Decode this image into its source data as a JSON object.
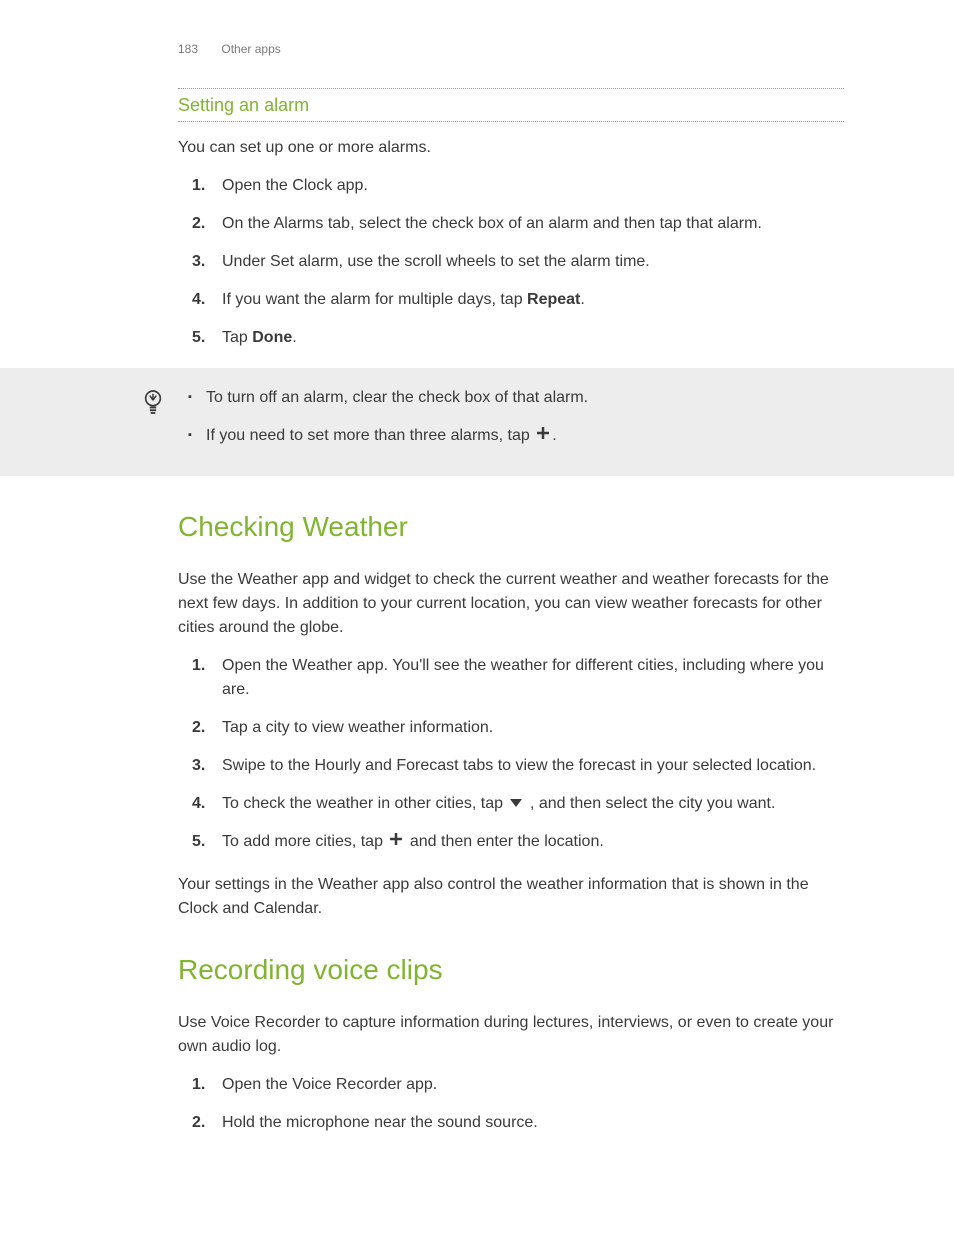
{
  "header": {
    "pageNumber": "183",
    "sectionName": "Other apps"
  },
  "alarm": {
    "subheading": "Setting an alarm",
    "intro": "You can set up one or more alarms.",
    "steps": {
      "s1": "Open the Clock app.",
      "s2": "On the Alarms tab, select the check box of an alarm and then tap that alarm.",
      "s3": "Under Set alarm, use the scroll wheels to set the alarm time.",
      "s4_pre": "If you want the alarm for multiple days, tap ",
      "s4_bold": "Repeat",
      "s4_post": ".",
      "s5_pre": "Tap ",
      "s5_bold": "Done",
      "s5_post": "."
    },
    "tips": {
      "t1": "To turn off an alarm, clear the check box of that alarm.",
      "t2_pre": "If you need to set more than three alarms, tap ",
      "t2_post": "."
    }
  },
  "weather": {
    "heading": "Checking Weather",
    "intro": "Use the Weather app and widget to check the current weather and weather forecasts for the next few days. In addition to your current location, you can view weather forecasts for other cities around the globe.",
    "steps": {
      "s1": "Open the Weather app. You'll see the weather for different cities, including where you are.",
      "s2": "Tap a city to view weather information.",
      "s3": "Swipe to the Hourly and Forecast tabs to view the forecast in your selected location.",
      "s4_pre": "To check the weather in other cities, tap ",
      "s4_post": " , and then select the city you want.",
      "s5_pre": "To add more cities, tap ",
      "s5_post": " and then enter the location."
    },
    "outro": "Your settings in the Weather app also control the weather information that is shown in the Clock and Calendar."
  },
  "voice": {
    "heading": "Recording voice clips",
    "intro": "Use Voice Recorder to capture information during lectures, interviews, or even to create your own audio log.",
    "steps": {
      "s1": "Open the Voice Recorder app.",
      "s2": "Hold the microphone near the sound source."
    }
  }
}
